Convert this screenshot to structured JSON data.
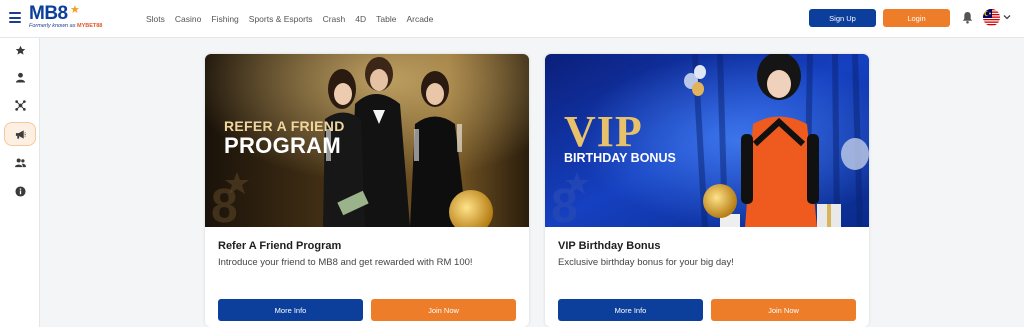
{
  "brand": {
    "logo_text_main": "MB8",
    "logo_subtitle_prefix": "Formerly known as",
    "logo_subtitle_brand": "MYBET88"
  },
  "nav": {
    "items": [
      "Slots",
      "Casino",
      "Fishing",
      "Sports & Esports",
      "Crash",
      "4D",
      "Table",
      "Arcade"
    ]
  },
  "header": {
    "signup_label": "Sign Up",
    "login_label": "Login"
  },
  "sidebar": {
    "items": [
      {
        "icon": "star-icon"
      },
      {
        "icon": "user-icon"
      },
      {
        "icon": "network-icon"
      },
      {
        "icon": "megaphone-icon",
        "active": true
      },
      {
        "icon": "users-icon"
      },
      {
        "icon": "info-icon"
      }
    ]
  },
  "promotions": [
    {
      "banner_line1": "REFER A FRIEND",
      "banner_line2": "PROGRAM",
      "title": "Refer A Friend Program",
      "description": "Introduce your friend to MB8 and get rewarded with RM 100!",
      "more_label": "More Info",
      "join_label": "Join Now"
    },
    {
      "banner_line1": "VIP",
      "banner_line2": "BIRTHDAY BONUS",
      "title": "VIP Birthday Bonus",
      "description": "Exclusive birthday bonus for your big day!",
      "more_label": "More Info",
      "join_label": "Join Now"
    }
  ],
  "colors": {
    "primary": "#0c3f9c",
    "accent": "#ee7d2a"
  }
}
